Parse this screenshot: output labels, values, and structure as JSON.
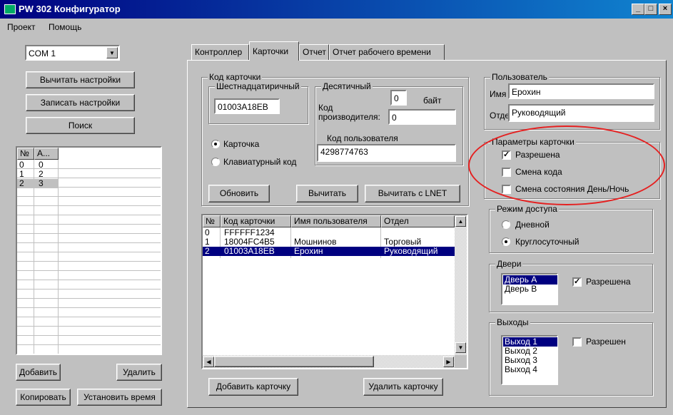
{
  "window": {
    "title": "PW 302 Конфигуратор",
    "minimize": "_",
    "maximize": "□",
    "close": "×"
  },
  "menu": {
    "project": "Проект",
    "help": "Помощь"
  },
  "left": {
    "port": "COM 1",
    "read_settings": "Вычитать настройки",
    "write_settings": "Записать настройки",
    "search": "Поиск",
    "table": {
      "col_no": "№",
      "col_addr": "А...",
      "rows": [
        [
          "0",
          "0"
        ],
        [
          "1",
          "2"
        ],
        [
          "2",
          "3"
        ]
      ]
    },
    "add": "Добавить",
    "delete": "Удалить",
    "copy": "Копировать",
    "set_time": "Установить время"
  },
  "tabs": [
    "Контроллер",
    "Карточки",
    "Отчет",
    "Отчет рабочего времени"
  ],
  "card_code": {
    "group": "Код карточки",
    "hex_group": "Шестнадцатиричный",
    "hex_value": "01003A18EB",
    "dec_group": "Десятичный",
    "byte_value": "0",
    "byte_label": "байт",
    "mfr_label_1": "Код",
    "mfr_label_2": "производителя:",
    "mfr_value": "0",
    "user_code_label": "Код пользователя",
    "user_code_value": "4298774763",
    "type_card": "Карточка",
    "type_keypad": "Клавиатурный код",
    "refresh": "Обновить",
    "read": "Вычитать",
    "read_lnet": "Вычитать с LNET"
  },
  "cards_table": {
    "headers": [
      "№",
      "Код карточки",
      "Имя пользователя",
      "Отдел"
    ],
    "rows": [
      [
        "0",
        "FFFFFF1234",
        "",
        ""
      ],
      [
        "1",
        "18004FC4B5",
        "Мошнинов",
        "Торговый"
      ],
      [
        "2",
        "01003A18EB",
        "Ерохин",
        "Руководящий"
      ]
    ],
    "selected": 2
  },
  "add_card": "Добавить карточку",
  "delete_card": "Удалить карточку",
  "user": {
    "group": "Пользователь",
    "name_label": "Имя",
    "name_value": "Ерохин",
    "dept_label": "Отдел",
    "dept_value": "Руководящий"
  },
  "card_params": {
    "group": "Параметры карточки",
    "allowed": "Разрешена",
    "code_change": "Смена кода",
    "day_night": "Смена состояния День/Ночь",
    "check_mark": "✓"
  },
  "access": {
    "group": "Режим доступа",
    "day": "Дневной",
    "round_clock": "Круглосуточный"
  },
  "doors": {
    "group": "Двери",
    "items": [
      "Дверь А",
      "Дверь В"
    ],
    "allowed": "Разрешена"
  },
  "outputs": {
    "group": "Выходы",
    "items": [
      "Выход 1",
      "Выход 2",
      "Выход 3",
      "Выход 4"
    ],
    "allowed": "Разрешен"
  },
  "icons": {
    "dropdown": "▼",
    "scroll_up": "▲",
    "scroll_down": "▼",
    "scroll_left": "◀",
    "scroll_right": "▶"
  }
}
